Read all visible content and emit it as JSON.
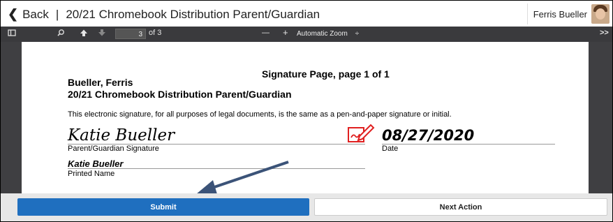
{
  "header": {
    "back_label": "Back",
    "separator": "|",
    "title": "20/21 Chromebook Distribution Parent/Guardian",
    "user_name": "Ferris Bueller"
  },
  "toolbar": {
    "page_current": "3",
    "page_total": "of 3",
    "zoom_minus": "—",
    "zoom_plus": "+",
    "zoom_label": "Automatic Zoom",
    "zoom_caret": "÷",
    "more": ">>"
  },
  "document": {
    "signature_title": "Signature Page, page 1 of 1",
    "student_name": "Bueller, Ferris",
    "document_name": "20/21 Chromebook Distribution Parent/Guardian",
    "legal_text": "This electronic signature, for all purposes of legal documents, is the same as a pen-and-paper signature or initial.",
    "signature_value": "Katie Bueller",
    "signature_label": "Parent/Guardian Signature",
    "date_value": "08/27/2020",
    "date_label": "Date",
    "printed_value": "Katie Bueller",
    "printed_label": "Printed Name"
  },
  "actions": {
    "submit_label": "Submit",
    "next_label": "Next Action"
  },
  "colors": {
    "submit_bg": "#1f6fbf",
    "toolbar_bg": "#3a3a3d",
    "sign_icon": "#e02020",
    "arrow": "#3b5378"
  },
  "icons": [
    "chevron-left-icon",
    "sidebar-toggle-icon",
    "search-icon",
    "arrow-up-icon",
    "arrow-down-icon",
    "sign-here-icon",
    "annotation-arrow-icon"
  ]
}
